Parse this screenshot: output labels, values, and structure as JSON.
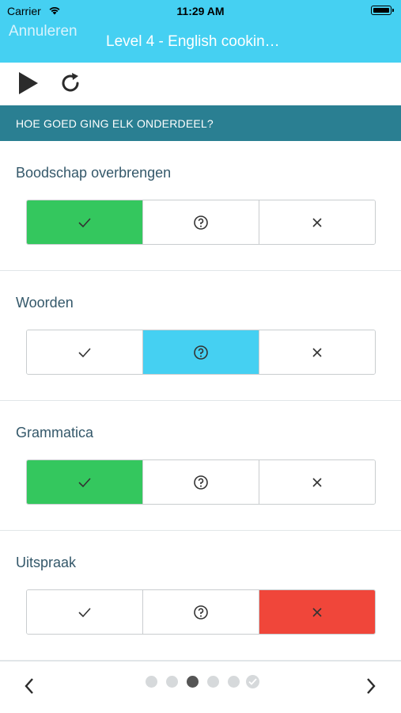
{
  "status": {
    "carrier": "Carrier",
    "time": "11:29 AM"
  },
  "nav": {
    "cancel_label": "Annuleren",
    "title": "Level 4 - English cookin…"
  },
  "toolbar": {
    "play_icon": "play-icon",
    "refresh_icon": "refresh-icon"
  },
  "section": {
    "header": "HOE GOED GING ELK ONDERDEEL?"
  },
  "criteria": [
    {
      "label": "Boodschap overbrengen",
      "selected": "good"
    },
    {
      "label": "Woorden",
      "selected": "unsure"
    },
    {
      "label": "Grammatica",
      "selected": "good"
    },
    {
      "label": "Uitspraak",
      "selected": "bad"
    }
  ],
  "options": [
    "checkmark-icon",
    "question-icon",
    "cross-icon"
  ],
  "colors": {
    "accent": "#45d0f2",
    "header": "#2a7f92",
    "good": "#34c75e",
    "unsure": "#45d0f2",
    "bad": "#f0463a"
  },
  "pager": {
    "total": 6,
    "current": 3,
    "last_completed": true
  }
}
